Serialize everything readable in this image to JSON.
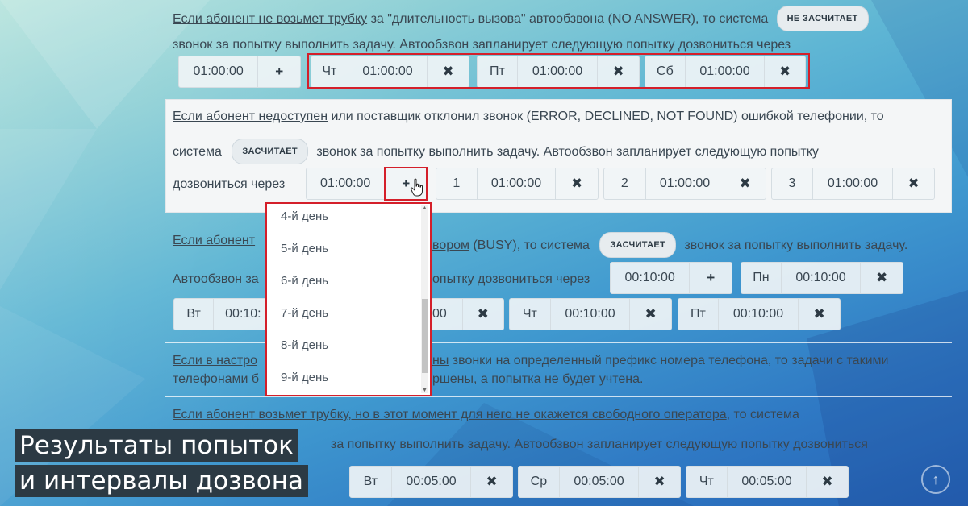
{
  "section1": {
    "line1_link": "Если абонент не возьмет трубку",
    "line1_rest": " за \"длительность вызова\" автообзвона (NO ANSWER), то система",
    "badge": "НЕ ЗАСЧИТАЕТ",
    "line2": "звонок за попытку выполнить задачу. Автообзвон запланирует следующую попытку дозвониться через",
    "base_time": "01:00:00",
    "add_symbol": "+",
    "slots": [
      {
        "day": "Чт",
        "time": "01:00:00"
      },
      {
        "day": "Пт",
        "time": "01:00:00"
      },
      {
        "day": "Сб",
        "time": "01:00:00"
      }
    ]
  },
  "section2": {
    "line1_link": "Если абонент недоступен",
    "line1_rest": " или поставщик отклонил звонок (ERROR, DECLINED, NOT FOUND) ошибкой телефонии, то",
    "line2_pre": "система",
    "badge": "ЗАСЧИТАЕТ",
    "line2_post": "звонок за попытку выполнить задачу. Автообзвон запланирует следующую попытку",
    "line3": "дозвониться через",
    "base_time": "01:00:00",
    "add_symbol": "+",
    "slots": [
      {
        "day": "1",
        "time": "01:00:00"
      },
      {
        "day": "2",
        "time": "01:00:00"
      },
      {
        "day": "3",
        "time": "01:00:00"
      }
    ]
  },
  "dropdown": {
    "items": [
      "4-й день",
      "5-й день",
      "6-й день",
      "7-й день",
      "8-й день",
      "9-й день"
    ],
    "arrow_up": "▲",
    "arrow_down": "▼"
  },
  "section3": {
    "line1_link_a": "Если абонент",
    "line1_link_b": "вором",
    "line1_rest": " (BUSY), то система",
    "badge": "ЗАСЧИТАЕТ",
    "line1_post": "звонок за попытку выполнить задачу.",
    "line2_a": "Автообзвон за",
    "line2_b": "опытку дозвониться через",
    "base_time": "00:10:00",
    "add_symbol": "+",
    "slot_mon": {
      "day": "Пн",
      "time": "00:10:00"
    },
    "slot_tue": {
      "day": "Вт",
      "time": "00:10:"
    },
    "slot_wed_time": "00",
    "slot_thu": {
      "day": "Чт",
      "time": "00:10:00"
    },
    "slot_fri": {
      "day": "Пт",
      "time": "00:10:00"
    }
  },
  "section4": {
    "line1_link_a": "Если в настро",
    "line1_link_b": "ны",
    "line1_rest": " звонки на определенный префикс номера телефона, то задачи с такими",
    "line2_a": "телефонами б",
    "line2_b": "ршены, а попытка не будет учтена."
  },
  "section5": {
    "line1_link": "Если абонент возьмет трубку, но в этот момент для него не окажется свободного оператора",
    "line1_rest": ", то система",
    "line2": "за попытку выполнить задачу. Автообзвон запланирует следующую попытку дозвониться",
    "slots": [
      {
        "day": "Вт",
        "time": "00:05:00"
      },
      {
        "day": "Ср",
        "time": "00:05:00"
      },
      {
        "day": "Чт",
        "time": "00:05:00"
      }
    ]
  },
  "remove_symbol": "✖",
  "scroll_top_symbol": "↑",
  "caption": {
    "line1": "Результаты попыток",
    "line2": "и интервалы дозвона"
  }
}
